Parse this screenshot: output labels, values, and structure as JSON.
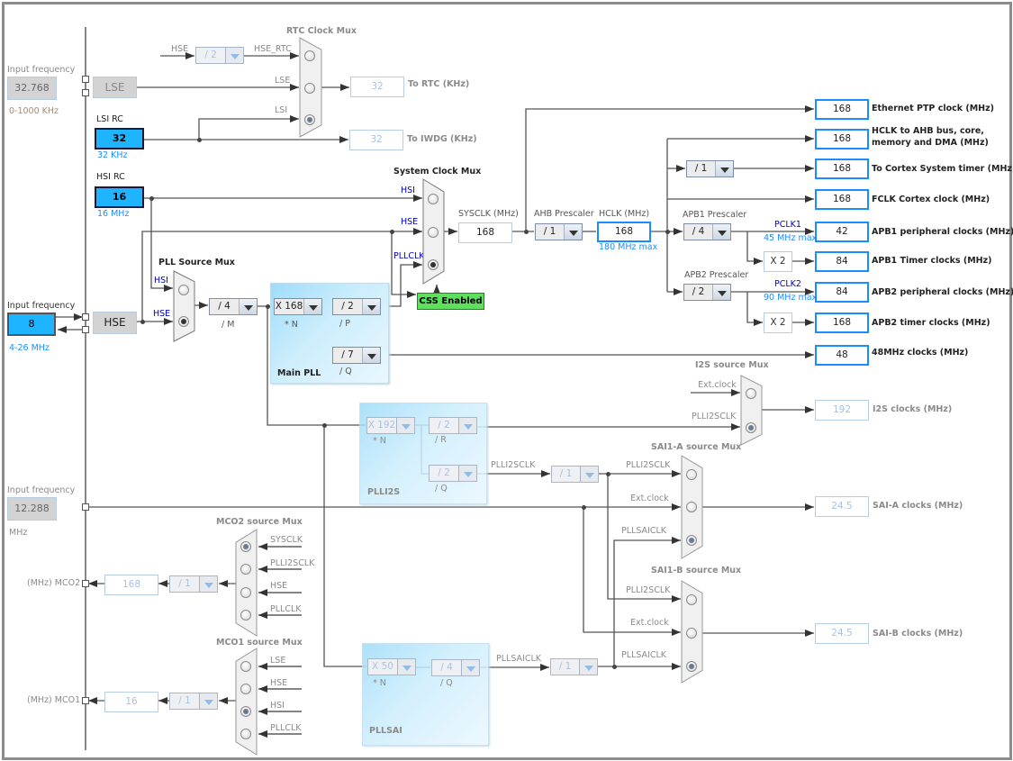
{
  "rtc": {
    "title": "RTC Clock Mux",
    "hse_label": "HSE",
    "hse_div": "/ 2",
    "hse_rtc_label": "HSE_RTC",
    "lse_label": "LSE",
    "lsi_label": "LSI",
    "selected": "LSI",
    "out_value": "32",
    "out_label": "To RTC (KHz)",
    "iwdg_value": "32",
    "iwdg_label": "To IWDG (KHz)"
  },
  "lse": {
    "input_label": "Input frequency",
    "value": "32.768",
    "range": "0-1000 KHz",
    "name": "LSE"
  },
  "lsi": {
    "title": "LSI RC",
    "value": "32",
    "freq": "32 KHz"
  },
  "hsi": {
    "title": "HSI RC",
    "value": "16",
    "freq": "16 MHz"
  },
  "hse": {
    "input_label": "Input frequency",
    "value": "8",
    "range": "4-26 MHz",
    "name": "HSE"
  },
  "pll_source_mux": {
    "title": "PLL Source Mux",
    "hsi": "HSI",
    "hse": "HSE",
    "selected": "HSE"
  },
  "main_pll": {
    "title": "Main PLL",
    "m": "/ 4",
    "m_label": "/ M",
    "n": "X 168",
    "n_label": "* N",
    "p": "/ 2",
    "p_label": "/ P",
    "q": "/ 7",
    "q_label": "/ Q"
  },
  "system_mux": {
    "title": "System Clock Mux",
    "hsi": "HSI",
    "hse": "HSE",
    "pllclk": "PLLCLK",
    "selected": "PLLCLK",
    "css": "CSS Enabled"
  },
  "sysclk": {
    "label": "SYSCLK (MHz)",
    "value": "168"
  },
  "ahb": {
    "label": "AHB Prescaler",
    "hclk_label": "HCLK (MHz)",
    "div": "/ 1",
    "hclk": "168",
    "max": "180 MHz max"
  },
  "cortex_div": "/ 1",
  "apb1": {
    "label": "APB1 Prescaler",
    "div": "/ 4",
    "pclk": "PCLK1",
    "max": "45 MHz max",
    "mult": "X 2"
  },
  "apb2": {
    "label": "APB2 Prescaler",
    "div": "/ 2",
    "pclk": "PCLK2",
    "max": "90 MHz max",
    "mult": "X 2"
  },
  "outputs": [
    {
      "value": "168",
      "label": "Ethernet PTP clock (MHz)"
    },
    {
      "value": "168",
      "label": "HCLK to AHB bus, core,",
      "label2": "memory and DMA (MHz)"
    },
    {
      "value": "168",
      "label": "To Cortex System timer (MHz)"
    },
    {
      "value": "168",
      "label": "FCLK Cortex clock (MHz)"
    },
    {
      "value": "42",
      "label": "APB1 peripheral clocks (MHz)"
    },
    {
      "value": "84",
      "label": "APB1 Timer clocks (MHz)"
    },
    {
      "value": "84",
      "label": "APB2 peripheral clocks (MHz)"
    },
    {
      "value": "168",
      "label": "APB2 timer clocks (MHz)"
    },
    {
      "value": "48",
      "label": "48MHz clocks (MHz)"
    }
  ],
  "plli2s": {
    "title": "PLLI2S",
    "n": "X 192",
    "n_label": "* N",
    "r": "/ 2",
    "r_label": "/ R",
    "q": "/ 2",
    "q_label": "/ Q",
    "clk_label": "PLLI2SCLK",
    "div": "/ 1"
  },
  "i2s_mux": {
    "title": "I2S source Mux",
    "ext": "Ext.clock",
    "plli2sclk": "PLLI2SCLK",
    "selected": "PLLI2SCLK",
    "out_value": "192",
    "out_label": "I2S clocks (MHz)"
  },
  "sai_a": {
    "title": "SAI1-A source Mux",
    "plli2sclk": "PLLI2SCLK",
    "ext": "Ext.clock",
    "pllsaiclk": "PLLSAICLK",
    "selected": "PLLSAICLK",
    "out_value": "24.5",
    "out_label": "SAI-A clocks (MHz)"
  },
  "sai_b": {
    "title": "SAI1-B source Mux",
    "plli2sclk": "PLLI2SCLK",
    "ext": "Ext.clock",
    "pllsaiclk": "PLLSAICLK",
    "selected": "PLLSAICLK",
    "out_value": "24.5",
    "out_label": "SAI-B clocks (MHz)"
  },
  "pllsai": {
    "title": "PLLSAI",
    "n": "X 50",
    "n_label": "* N",
    "q": "/ 4",
    "q_label": "/ Q",
    "clk_label": "PLLSAICLK",
    "div": "/ 1"
  },
  "ext_input": {
    "label": "Input frequency",
    "value": "12.288",
    "unit": "MHz"
  },
  "mco2": {
    "title": "MCO2 source Mux",
    "inputs": [
      "SYSCLK",
      "PLLI2SCLK",
      "HSE",
      "PLLCLK"
    ],
    "selected": "SYSCLK",
    "div": "/ 1",
    "value": "168",
    "label": "(MHz) MCO2"
  },
  "mco1": {
    "title": "MCO1 source Mux",
    "inputs": [
      "LSE",
      "HSE",
      "HSI",
      "PLLCLK"
    ],
    "selected": "HSI",
    "div": "/ 1",
    "value": "16",
    "label": "(MHz) MCO1"
  },
  "colors": {
    "active_output_border": "#1a8cff",
    "oscillator_fill": "#1eb4ff",
    "css_enabled": "#5ee05e",
    "pll_panel": "#9fdcfa",
    "signal_label": "#0000c8"
  }
}
